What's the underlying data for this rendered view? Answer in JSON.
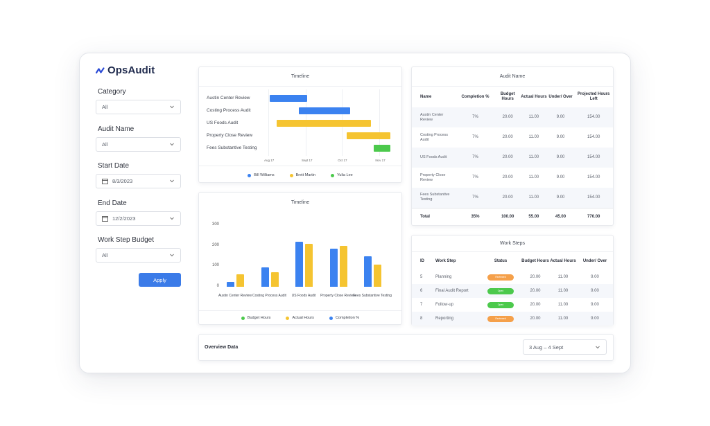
{
  "brand": {
    "name": "OpsAudit",
    "logo_color": "#2b4bd6"
  },
  "filters": {
    "category": {
      "label": "Category",
      "value": "All"
    },
    "audit_name": {
      "label": "Audit Name",
      "value": "All"
    },
    "start_date": {
      "label": "Start Date",
      "value": "8/3/2023"
    },
    "end_date": {
      "label": "End Date",
      "value": "12/2/2023"
    },
    "work_step_budget": {
      "label": "Work Step Budget",
      "value": "All"
    },
    "apply_label": "Apply"
  },
  "timeline_gantt": {
    "title": "Timeline",
    "rows": [
      {
        "label": "Austin Center Review",
        "start": "2017-08-02",
        "end": "2017-09-02",
        "owner": "Bill Williams"
      },
      {
        "label": "Costing Process Audit",
        "start": "2017-08-26",
        "end": "2017-10-08",
        "owner": "Bill Williams"
      },
      {
        "label": "US Foods Audit",
        "start": "2017-08-08",
        "end": "2017-10-25",
        "owner": "Brett Martin"
      },
      {
        "label": "Property Close Review",
        "start": "2017-10-05",
        "end": "2017-11-10",
        "owner": "Brett Martin"
      },
      {
        "label": "Fees Substantive Testing",
        "start": "2017-10-27",
        "end": "2017-11-10",
        "owner": "Yulia Lee"
      }
    ],
    "ticks": [
      "Aug 17",
      "Sept 17",
      "Oct 17",
      "Nov 17"
    ],
    "legend": [
      {
        "name": "Bill Williams",
        "color": "#3b82f0"
      },
      {
        "name": "Brett Martin",
        "color": "#f5c431"
      },
      {
        "name": "Yulia Lee",
        "color": "#4cc94c"
      }
    ]
  },
  "timeline_bars": {
    "title": "Timeline",
    "legend": [
      {
        "name": "Budget Hours",
        "color": "#4cc94c"
      },
      {
        "name": "Actual Hours",
        "color": "#f5c431"
      },
      {
        "name": "Completion %",
        "color": "#3b82f0"
      }
    ]
  },
  "chart_data": {
    "type": "bar",
    "categories": [
      "Austin Center Review",
      "Costing Process Audit",
      "US Foods Audit",
      "Property Close Review",
      "Fees Substantive Testing"
    ],
    "series": [
      {
        "name": "Completion %",
        "color": "#3b82f0",
        "values": [
          25,
          95,
          218,
          185,
          148
        ]
      },
      {
        "name": "Actual Hours",
        "color": "#f5c431",
        "values": [
          60,
          72,
          208,
          198,
          108
        ]
      }
    ],
    "yticks": [
      "0",
      "100",
      "200",
      "300"
    ],
    "ylim": [
      0,
      300
    ]
  },
  "audit_table": {
    "title": "Audit Name",
    "headers": [
      "Name",
      "Completion %",
      "Budget Hours",
      "Actual Hours",
      "Under/ Over",
      "Projected Hours Left"
    ],
    "rows": [
      [
        "Austin Center Review",
        "7%",
        "20.00",
        "11.00",
        "9.00",
        "154.00"
      ],
      [
        "Costing Process Audit",
        "7%",
        "20.00",
        "11.00",
        "9.00",
        "154.00"
      ],
      [
        "US Foods Audit",
        "7%",
        "20.00",
        "11.00",
        "9.00",
        "154.00"
      ],
      [
        "Property Close Review",
        "7%",
        "20.00",
        "11.00",
        "9.00",
        "154.00"
      ],
      [
        "Fees Substantive Testing",
        "7%",
        "20.00",
        "11.00",
        "9.00",
        "154.00"
      ]
    ],
    "total": [
      "Total",
      "35%",
      "100.00",
      "55.00",
      "45.00",
      "770.00"
    ]
  },
  "work_steps": {
    "title": "Work Steps",
    "headers": [
      "ID",
      "Work Step",
      "Status",
      "Budget Hours",
      "Actual Hours",
      "Under/ Over"
    ],
    "rows": [
      {
        "id": "5",
        "step": "Planning",
        "status": "Reviewed",
        "status_color": "#f5a04a",
        "budget": "20.00",
        "actual": "11.00",
        "under_over": "9.00"
      },
      {
        "id": "6",
        "step": "Final Audit Report",
        "status": "Open",
        "status_color": "#4cc94c",
        "budget": "20.00",
        "actual": "11.00",
        "under_over": "9.00"
      },
      {
        "id": "7",
        "step": "Follow-up",
        "status": "Open",
        "status_color": "#4cc94c",
        "budget": "20.00",
        "actual": "11.00",
        "under_over": "9.00"
      },
      {
        "id": "8",
        "step": "Reporting",
        "status": "Reviewed",
        "status_color": "#f5a04a",
        "budget": "20.00",
        "actual": "11.00",
        "under_over": "9.00"
      }
    ]
  },
  "overview": {
    "title": "Overview Data",
    "range": "3 Aug – 4 Sept"
  }
}
